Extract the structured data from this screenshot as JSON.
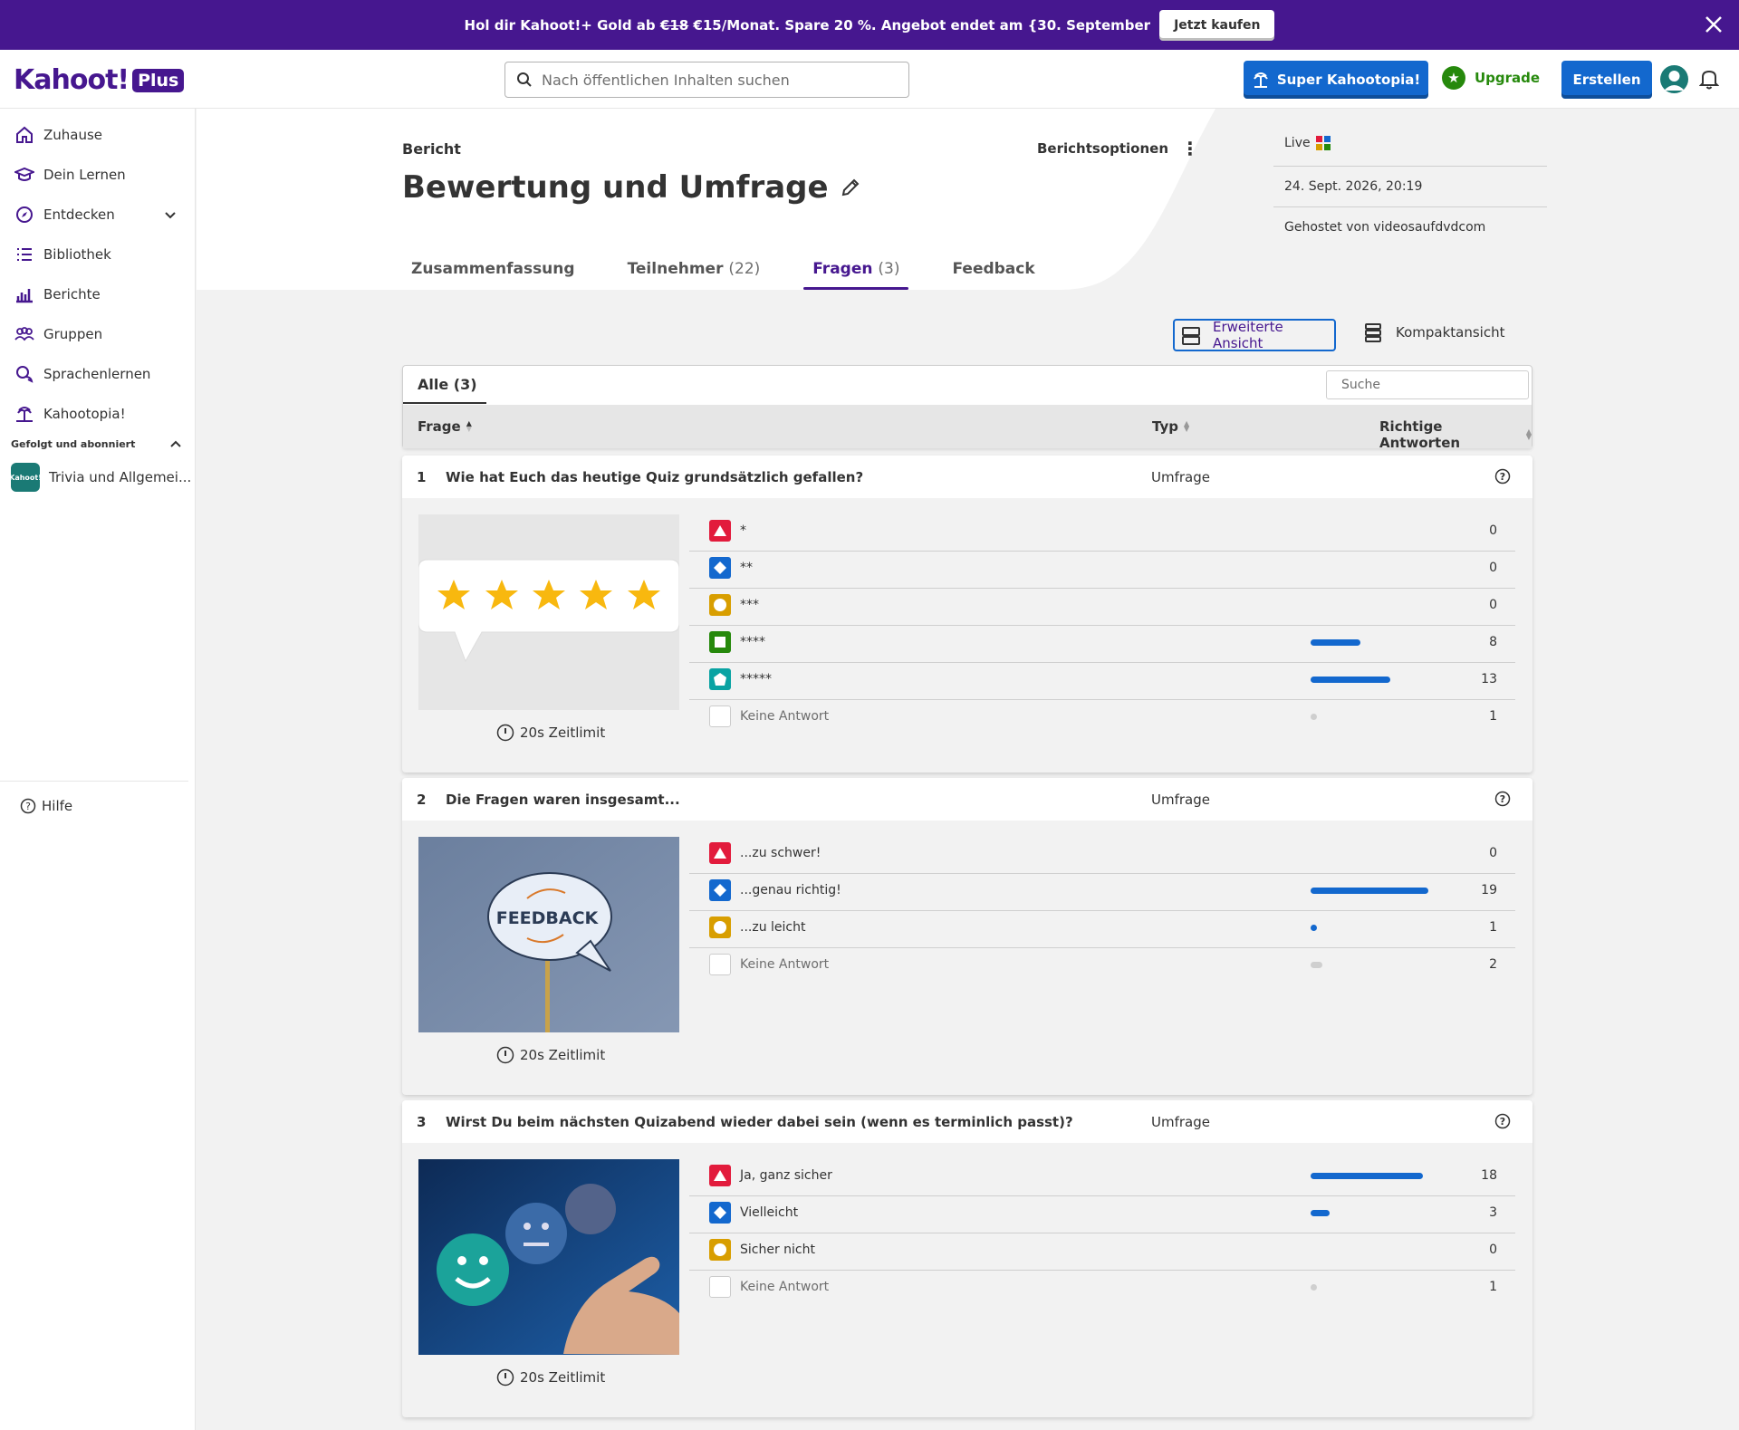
{
  "banner": {
    "text_pre": "Hol dir Kahoot!+ Gold ab ",
    "old_price": "€18",
    "text_post": " €15/Monat. Spare 20 %. Angebot endet am {30. September",
    "buy_label": "Jetzt kaufen"
  },
  "header": {
    "logo_text": "Kahoot!",
    "logo_badge": "Plus",
    "search_placeholder": "Nach öffentlichen Inhalten suchen",
    "super_label": "Super Kahootopia!",
    "upgrade_label": "Upgrade",
    "create_label": "Erstellen"
  },
  "sidebar": {
    "items": [
      {
        "label": "Zuhause",
        "icon": "home-icon"
      },
      {
        "label": "Dein Lernen",
        "icon": "graduation-cap-icon"
      },
      {
        "label": "Entdecken",
        "icon": "compass-icon"
      },
      {
        "label": "Bibliothek",
        "icon": "list-icon"
      },
      {
        "label": "Berichte",
        "icon": "bar-chart-icon"
      },
      {
        "label": "Gruppen",
        "icon": "group-icon"
      },
      {
        "label": "Sprachenlernen",
        "icon": "language-icon"
      },
      {
        "label": "Kahootopia!",
        "icon": "island-icon"
      }
    ],
    "follow_heading": "Gefolgt und abonniert",
    "follow_item": "Trivia und Allgemei...",
    "follow_avatar": "Kahoot!",
    "help_label": "Hilfe"
  },
  "report": {
    "crumb": "Bericht",
    "title": "Bewertung und Umfrage",
    "options_label": "Berichtsoptionen",
    "live": "Live",
    "date": "24. Sept. 2026, 20:19",
    "host": "Gehostet von videosaufdvdcom"
  },
  "tabs": [
    {
      "label": "Zusammenfassung",
      "count": ""
    },
    {
      "label": "Teilnehmer",
      "count": "(22)"
    },
    {
      "label": "Fragen",
      "count": "(3)"
    },
    {
      "label": "Feedback",
      "count": ""
    }
  ],
  "views": {
    "extended": "Erweiterte Ansicht",
    "compact": "Kompaktansicht"
  },
  "table": {
    "all_tab": "Alle (3)",
    "search_placeholder": "Suche",
    "col_question": "Frage",
    "col_type": "Typ",
    "col_correct": "Richtige Antworten"
  },
  "questions": [
    {
      "num": "1",
      "text": "Wie hat Euch das heutige Quiz grundsätzlich gefallen?",
      "type": "Umfrage",
      "time_limit": "20s Zeitlimit",
      "image": "stars",
      "answers": [
        {
          "label": "*",
          "value": "0",
          "fraction": 0,
          "shape": "red"
        },
        {
          "label": "**",
          "value": "0",
          "fraction": 0,
          "shape": "blue"
        },
        {
          "label": "***",
          "value": "0",
          "fraction": 0,
          "shape": "yellow"
        },
        {
          "label": "****",
          "value": "8",
          "fraction": 0.42,
          "shape": "green"
        },
        {
          "label": "*****",
          "value": "13",
          "fraction": 0.68,
          "shape": "teal"
        },
        {
          "label": "Keine Antwort",
          "value": "1",
          "fraction": 0.05,
          "shape": "none"
        }
      ]
    },
    {
      "num": "2",
      "text": "Die Fragen waren insgesamt...",
      "type": "Umfrage",
      "time_limit": "20s Zeitlimit",
      "image": "feedback",
      "image_text": "FEEDBACK",
      "answers": [
        {
          "label": "...zu schwer!",
          "value": "0",
          "fraction": 0,
          "shape": "red"
        },
        {
          "label": "...genau richtig!",
          "value": "19",
          "fraction": 1.0,
          "shape": "blue"
        },
        {
          "label": "...zu leicht",
          "value": "1",
          "fraction": 0.05,
          "shape": "yellow"
        },
        {
          "label": "Keine Antwort",
          "value": "2",
          "fraction": 0.1,
          "shape": "none"
        }
      ]
    },
    {
      "num": "3",
      "text": "Wirst Du beim nächsten Quizabend wieder dabei sein (wenn es terminlich passt)?",
      "type": "Umfrage",
      "time_limit": "20s Zeitlimit",
      "image": "smileys",
      "answers": [
        {
          "label": "Ja, ganz sicher",
          "value": "18",
          "fraction": 0.95,
          "shape": "red"
        },
        {
          "label": "Vielleicht",
          "value": "3",
          "fraction": 0.16,
          "shape": "blue"
        },
        {
          "label": "Sicher nicht",
          "value": "0",
          "fraction": 0,
          "shape": "yellow"
        },
        {
          "label": "Keine Antwort",
          "value": "1",
          "fraction": 0.05,
          "shape": "none"
        }
      ]
    }
  ]
}
